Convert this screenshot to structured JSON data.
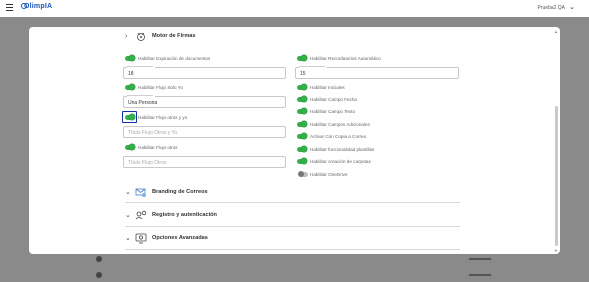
{
  "app": {
    "logo_text": "OlimpIA",
    "user_name": "Prueba2 QA"
  },
  "sections": {
    "motor": {
      "title": "Motor de Firmas"
    },
    "branding": {
      "title": "Branding de Correos"
    },
    "registro": {
      "title": "Registro y autenticación"
    },
    "opciones": {
      "title": "Opciones Avanzadas"
    }
  },
  "left_column": {
    "expiracion": {
      "label": "Habilitar Expiración de documentos",
      "on": true
    },
    "expiracion_days": {
      "value": "18"
    },
    "solo_yo": {
      "label": "Habilitar Flujo Solo Yo",
      "on": true
    },
    "solo_yo_value": {
      "value": "Una Persona"
    },
    "otros_y_yo": {
      "label": "Habilitar Flujo otros y yo",
      "on": true
    },
    "otros_y_yo_input": {
      "placeholder": "Título Flujo Otros y Yo"
    },
    "otros": {
      "label": "Habilitar Flujo otros",
      "on": true
    },
    "otros_input": {
      "placeholder": "Título Flujo Otros"
    }
  },
  "right_column": {
    "recordatorios": {
      "label": "Habilitar Recordatorios Automático",
      "on": true
    },
    "recordatorios_days": {
      "value": "15"
    },
    "iniciales": {
      "label": "Habilitar Iniciales",
      "on": true
    },
    "campo_fecha": {
      "label": "Habilitar Campo Fecha",
      "on": true
    },
    "campo_texto": {
      "label": "Habilitar Campo Texto",
      "on": true
    },
    "campos_adicionales": {
      "label": "Habilitar Campos Adicionales",
      "on": true
    },
    "copia_correo": {
      "label": "Activar Con Copia a Correo",
      "on": true
    },
    "plantillas": {
      "label": "Habilitar funcionalidad plantillas",
      "on": true
    },
    "carpetas": {
      "label": "Habilitar creación de carpetas",
      "on": true
    },
    "onedrive": {
      "label": "Habilitar OneDrive",
      "on": false
    }
  },
  "colors": {
    "toggle_on": "#34b14a",
    "toggle_off": "#bdbdbd",
    "focus_outline": "#1432a8",
    "brand": "#1a56b8"
  },
  "icons": {
    "menu": "hamburger-icon",
    "user_menu": "chevron-down-icon",
    "section_collapsed": "chevron-right-icon",
    "section_expanded": "chevron-down-icon"
  }
}
